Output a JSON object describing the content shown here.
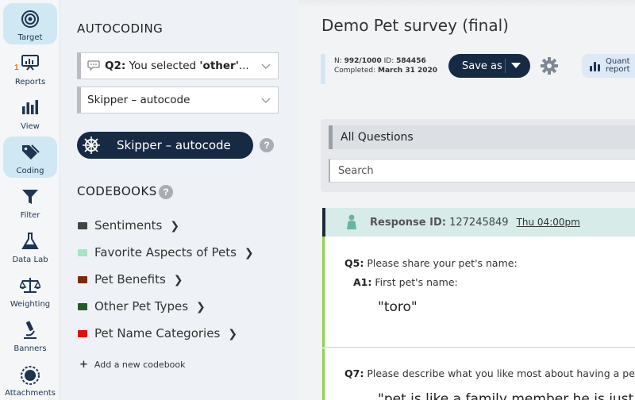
{
  "rail": {
    "items": [
      {
        "label": "Target",
        "icon": "target-icon",
        "active": true
      },
      {
        "label": "Reports",
        "icon": "reports-icon",
        "badge": "1"
      },
      {
        "label": "View",
        "icon": "bar-chart-icon"
      },
      {
        "label": "Coding",
        "icon": "tags-icon",
        "active": true
      },
      {
        "label": "Filter",
        "icon": "funnel-icon"
      },
      {
        "label": "Data Lab",
        "icon": "flask-icon"
      },
      {
        "label": "Weighting",
        "icon": "scale-icon"
      },
      {
        "label": "Banners",
        "icon": "microscope-icon"
      },
      {
        "label": "Attachments",
        "icon": "gear-badge-icon"
      }
    ]
  },
  "panel": {
    "title": "AUTOCODING",
    "question_select": {
      "prefix": "Q2:",
      "text": "You selected ",
      "bold": "'other'",
      "suffix": "..."
    },
    "mode_select": "Skipper – autocode",
    "skipper_button": "Skipper – autocode",
    "codebooks_title": "CODEBOOKS",
    "codebooks": [
      {
        "name": "Sentiments",
        "color": "#444444"
      },
      {
        "name": "Favorite Aspects of Pets",
        "color": "#a8e3c4"
      },
      {
        "name": "Pet Benefits",
        "color": "#7a2a10"
      },
      {
        "name": "Other Pet Types",
        "color": "#235a2a"
      },
      {
        "name": "Pet Name Categories",
        "color": "#e01010"
      }
    ],
    "add_codebook": "Add a new codebook"
  },
  "main": {
    "title": "Demo Pet survey (final)",
    "meta": {
      "n_label": "N:",
      "n_value": "992/1000",
      "id_label": "ID:",
      "id_value": "584456",
      "completed_label": "Completed:",
      "completed_value": "March 31 2020"
    },
    "save_as": "Save as",
    "quant_report": {
      "line1": "Quant",
      "line2": "report"
    },
    "all_questions": "All Questions",
    "search_placeholder": "Search",
    "response": {
      "id_label": "Response ID:",
      "id_value": "127245849",
      "time": "Thu 04:00pm",
      "q5": {
        "label": "Q5:",
        "text": "Please share your pet's name:"
      },
      "a1": {
        "label": "A1:",
        "text": "First pet's name:"
      },
      "answer1": "\"toro\"",
      "q7": {
        "label": "Q7:",
        "text": "Please describe what you like most about having a pet."
      },
      "answer2": "\"pet is like a family member he is just"
    }
  },
  "colors": {
    "navy": "#172a44",
    "active_rail": "#cfe8f3",
    "response_header": "#d7ebe9",
    "green_bar": "#8fcf4a"
  }
}
